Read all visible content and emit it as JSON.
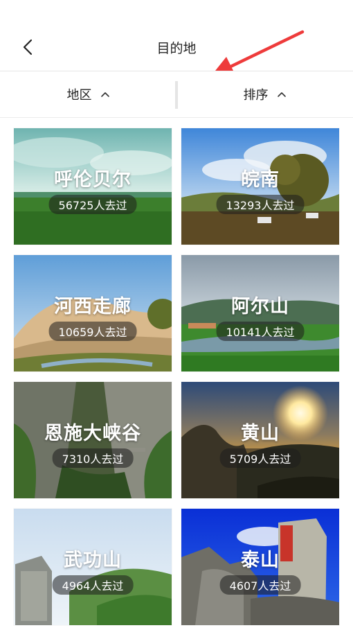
{
  "header": {
    "title": "目的地"
  },
  "filters": {
    "region": "地区",
    "sort": "排序"
  },
  "destinations": [
    {
      "name": "呼伦贝尔",
      "count": "56725人去过"
    },
    {
      "name": "皖南",
      "count": "13293人去过"
    },
    {
      "name": "河西走廊",
      "count": "10659人去过"
    },
    {
      "name": "阿尔山",
      "count": "10141人去过"
    },
    {
      "name": "恩施大峡谷",
      "count": "7310人去过"
    },
    {
      "name": "黄山",
      "count": "5709人去过"
    },
    {
      "name": "武功山",
      "count": "4964人去过"
    },
    {
      "name": "泰山",
      "count": "4607人去过"
    }
  ],
  "icons": {
    "back": "chevron-left-icon",
    "caret": "chevron-up-icon",
    "annotation": "red-arrow"
  },
  "colors": {
    "annotation": "#ee3b3b",
    "divider": "#e5e5e5"
  }
}
